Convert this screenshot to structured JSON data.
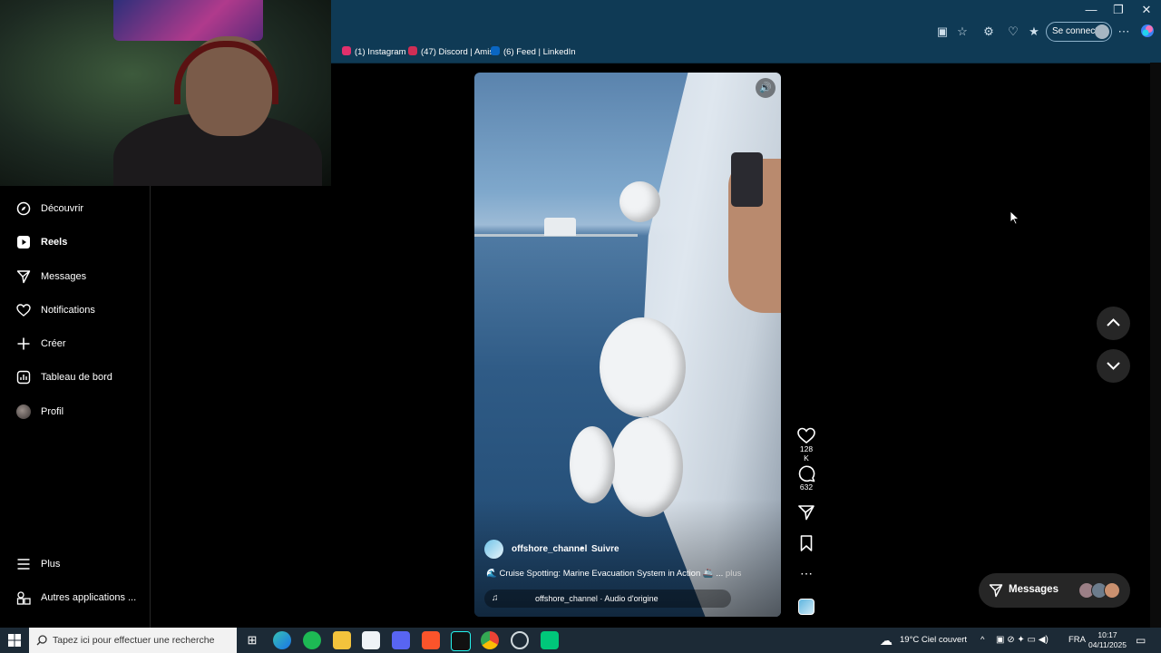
{
  "browser": {
    "window_controls": {
      "minimize": "—",
      "restore": "❐",
      "close": "✕"
    },
    "signin_label": "Se connecter",
    "bookmarks": [
      {
        "label": "(1) Instagram",
        "color": "#e1306c"
      },
      {
        "label": "(47) Discord | Amis",
        "color": "#cf2e55"
      },
      {
        "label": "(6) Feed | LinkedIn",
        "color": "#0a66c2"
      }
    ]
  },
  "sidebar": {
    "items": [
      {
        "label": "Découvrir",
        "icon": "compass-icon"
      },
      {
        "label": "Reels",
        "icon": "reels-icon",
        "active": true
      },
      {
        "label": "Messages",
        "icon": "paper-plane-icon"
      },
      {
        "label": "Notifications",
        "icon": "heart-icon"
      },
      {
        "label": "Créer",
        "icon": "plus-icon"
      },
      {
        "label": "Tableau de bord",
        "icon": "dashboard-icon"
      },
      {
        "label": "Profil",
        "icon": "avatar"
      }
    ],
    "bottom_items": [
      {
        "label": "Plus",
        "icon": "menu-icon"
      },
      {
        "label": "Autres applications ...",
        "icon": "apps-icon"
      }
    ]
  },
  "reel": {
    "author": "offshore_channel",
    "separator": "•",
    "follow_label": "Suivre",
    "caption": "🌊 Cruise Spotting: Marine Evacuation System in Action 🚢 ...",
    "more_label": "plus",
    "audio": "offshore_channel · Audio d'origine",
    "likes": "128 K",
    "comments": "632"
  },
  "messages_pill": {
    "label": "Messages"
  },
  "taskbar": {
    "search_placeholder": "Tapez ici pour effectuer une recherche",
    "weather": "19°C  Ciel couvert",
    "language": "FRA",
    "time": "10:17",
    "date": "04/11/2025"
  },
  "colors": {
    "browser_chrome": "#0f3a55",
    "background": "#000000",
    "taskbar": "#1c2a36"
  }
}
